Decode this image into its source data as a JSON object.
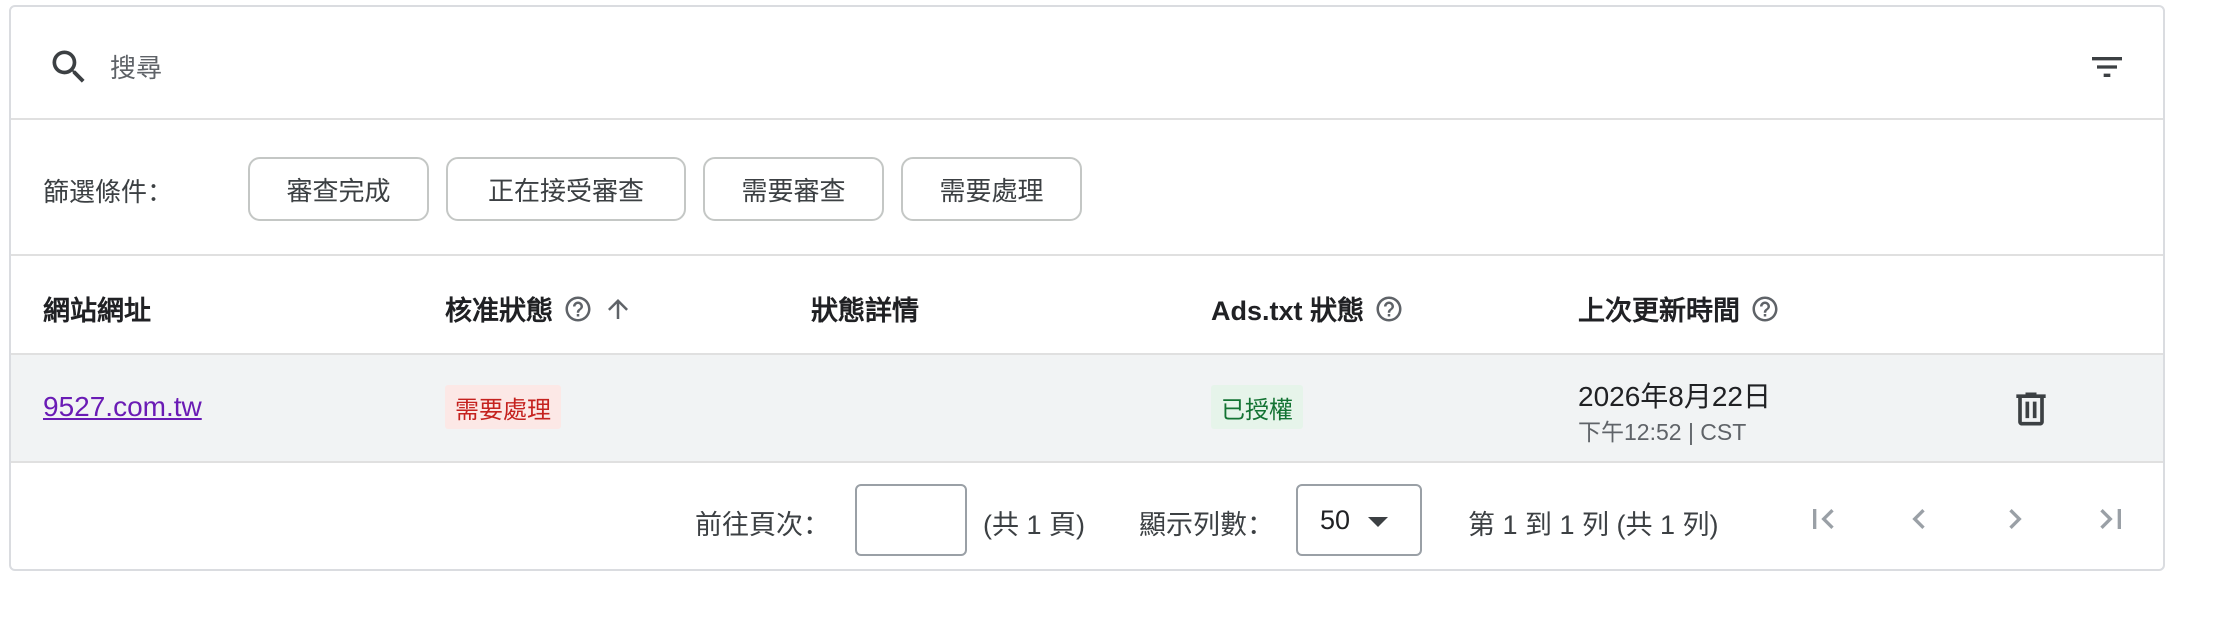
{
  "search": {
    "placeholder": "搜尋",
    "value": ""
  },
  "filters": {
    "label": "篩選條件：",
    "chips": [
      "審查完成",
      "正在接受審查",
      "需要審查",
      "需要處理"
    ]
  },
  "table": {
    "columns": [
      "網站網址",
      "核准狀態",
      "狀態詳情",
      "Ads.txt 狀態",
      "上次更新時間"
    ],
    "rows": [
      {
        "site": "9527.com.tw",
        "approval_status": "需要處理",
        "status_detail": "",
        "ads_txt_status": "已授權",
        "updated_date": "2026年8月22日",
        "updated_time": "下午12:52 | CST"
      }
    ]
  },
  "pagination": {
    "goto_label": "前往頁次：",
    "goto_value": "",
    "total_pages": "(共 1 頁)",
    "rows_label": "顯示列數：",
    "rows_value": "50",
    "range": "第 1 到 1 列 (共 1 列)"
  },
  "colors": {
    "accent_link": "#6a1bb5",
    "warn_bg": "#fce8e6",
    "warn_text": "#c5221f",
    "ok_bg": "#e6f4ea",
    "ok_text": "#137333",
    "row_highlight": "#f1f3f4"
  },
  "icons": [
    "search-icon",
    "filter-list-icon",
    "help-icon",
    "arrow-up-icon",
    "delete-icon",
    "first-page-icon",
    "chevron-left-icon",
    "chevron-right-icon",
    "last-page-icon",
    "arrow-drop-down-icon"
  ]
}
